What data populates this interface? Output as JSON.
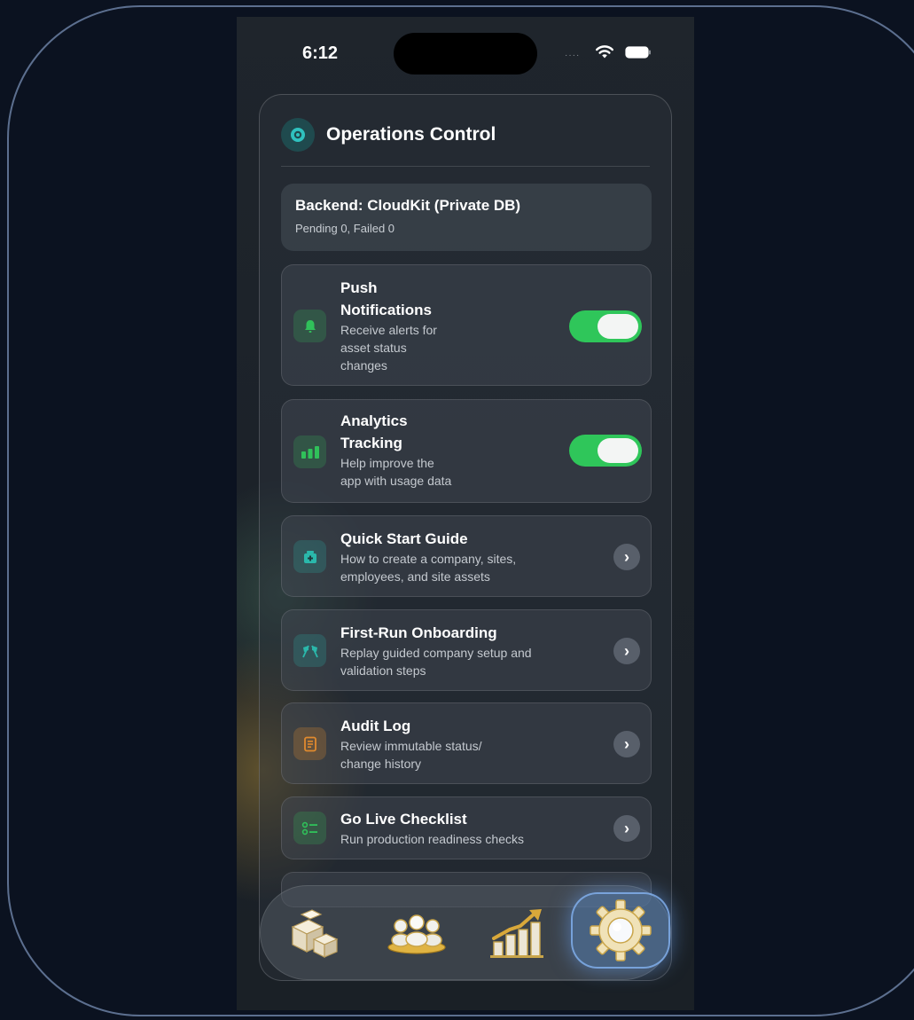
{
  "status_bar": {
    "time": "6:12",
    "signal": "····"
  },
  "panel": {
    "title": "Operations Control",
    "backend": {
      "title": "Backend: CloudKit (Private DB)",
      "subtitle": "Pending 0, Failed 0"
    },
    "rows": [
      {
        "title_lines": [
          "Push",
          "Notifications"
        ],
        "desc_lines": [
          "Receive alerts for",
          "asset status",
          "changes"
        ],
        "icon": "bell-icon",
        "control": "toggle",
        "enabled": true,
        "icon_color": "#30c15a"
      },
      {
        "title_lines": [
          "Analytics",
          "Tracking"
        ],
        "desc_lines": [
          "Help improve the",
          "app with usage data"
        ],
        "icon": "bar-chart-icon",
        "control": "toggle",
        "enabled": true,
        "icon_color": "#30c15a"
      },
      {
        "title_lines": [
          "Quick Start Guide"
        ],
        "desc_lines": [
          "How to create a company, sites,",
          "employees, and site assets"
        ],
        "icon": "first-aid-kit-icon",
        "control": "chevron",
        "icon_color": "#2ab8ab"
      },
      {
        "title_lines": [
          "First-Run Onboarding"
        ],
        "desc_lines": [
          "Replay guided company setup and",
          "validation steps"
        ],
        "icon": "flags-icon",
        "control": "chevron",
        "icon_color": "#2ab8ab"
      },
      {
        "title_lines": [
          "Audit Log"
        ],
        "desc_lines": [
          "Review immutable status/",
          "change history"
        ],
        "icon": "document-icon",
        "control": "chevron",
        "icon_color": "#e08a2e"
      },
      {
        "title_lines": [
          "Go Live Checklist"
        ],
        "desc_lines": [
          "Run production readiness checks"
        ],
        "icon": "checklist-icon",
        "control": "chevron",
        "icon_color": "#30c15a"
      }
    ]
  },
  "tabbar": {
    "tabs": [
      {
        "name": "assets",
        "icon": "boxes-icon",
        "active": false
      },
      {
        "name": "team",
        "icon": "people-icon",
        "active": false
      },
      {
        "name": "reports",
        "icon": "growth-chart-icon",
        "active": false
      },
      {
        "name": "settings",
        "icon": "gear-icon",
        "active": true
      }
    ]
  }
}
